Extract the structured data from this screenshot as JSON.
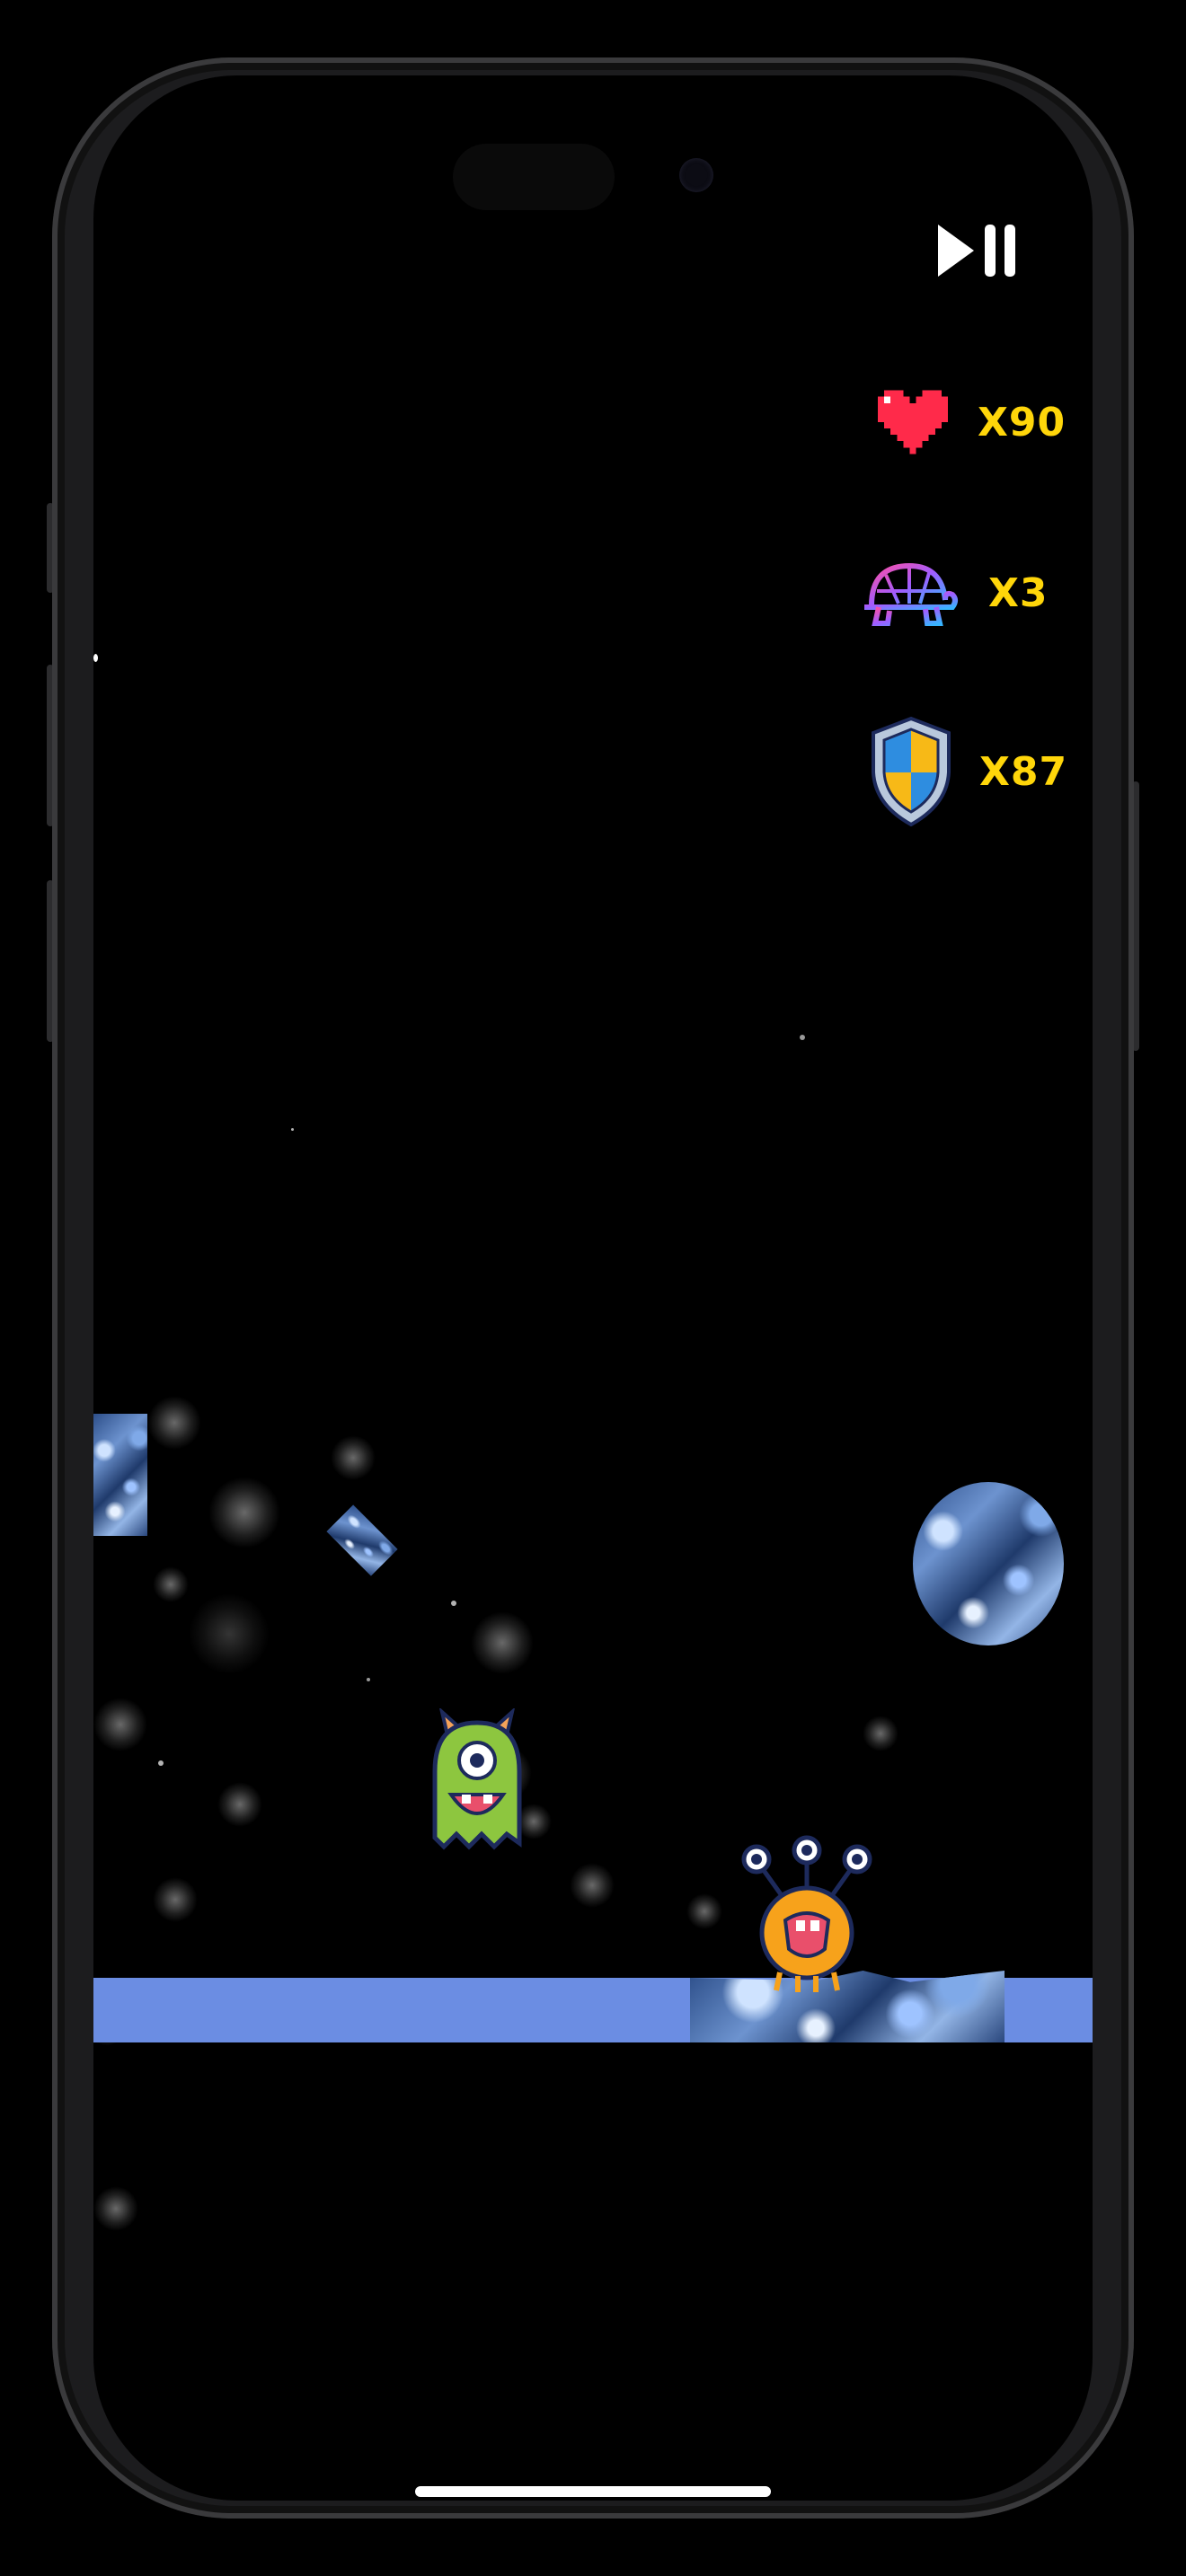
{
  "hud": {
    "lives": "X90",
    "slow": "X3",
    "shield": "X87"
  },
  "controls": {
    "play_pause_icon": "play-pause-icon"
  },
  "colors": {
    "hud_text": "#ffd60a",
    "ground": "#6b8de3",
    "background": "#000000",
    "heart": "#ff2a4a"
  },
  "sprites": [
    "green-cyclops-monster",
    "orange-three-eyed-alien",
    "ice-tile",
    "ice-planet",
    "ice-diamond"
  ]
}
